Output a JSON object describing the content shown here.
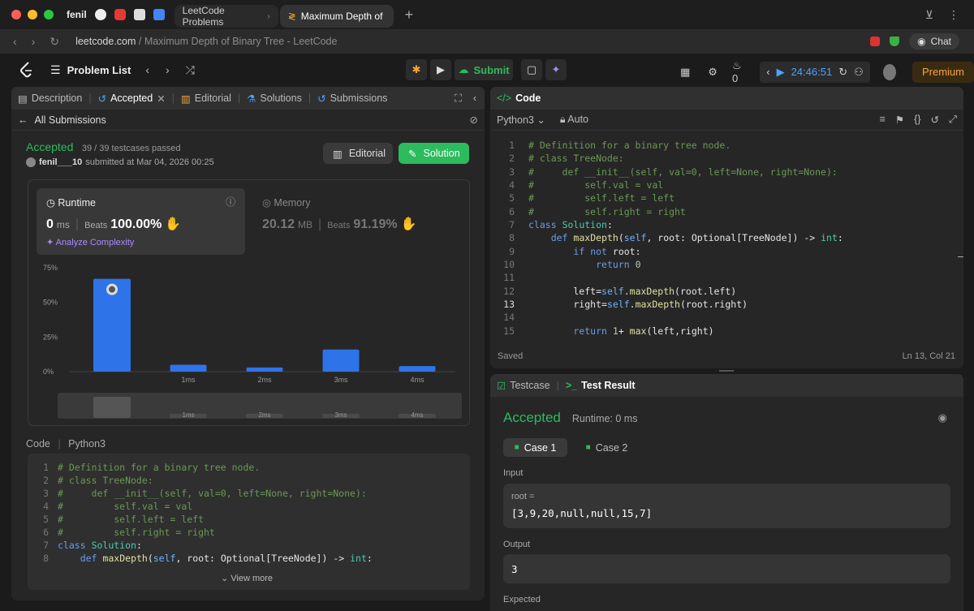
{
  "browser": {
    "profile": "fenil",
    "tabs": [
      {
        "title": "LeetCode Problems",
        "active": false
      },
      {
        "title": "Maximum Depth of Bina",
        "active": true
      }
    ],
    "url_domain": "leetcode.com",
    "url_path": " / Maximum Depth of Binary Tree - LeetCode",
    "chat_label": "Chat"
  },
  "header": {
    "problem_list": "Problem List",
    "submit": "Submit",
    "streak": "0",
    "timer": "24:46:51",
    "premium": "Premium"
  },
  "left": {
    "tabs": [
      "Description",
      "Accepted",
      "Editorial",
      "Solutions",
      "Submissions"
    ],
    "all_submissions": "All Submissions",
    "status": "Accepted",
    "testcases": "39 / 39 testcases passed",
    "user": "fenil___10",
    "submitted": "submitted at Mar 04, 2026 00:25",
    "editorial_btn": "Editorial",
    "solution_btn": "Solution",
    "runtime_label": "Runtime",
    "runtime_value": "0",
    "runtime_unit": "ms",
    "beats_label": "Beats",
    "runtime_beats": "100.00%",
    "analyze": "Analyze Complexity",
    "memory_label": "Memory",
    "memory_value": "20.12",
    "memory_unit": "MB",
    "memory_beats": "91.19%",
    "code_label": "Code",
    "code_lang": "Python3",
    "view_more": "View more"
  },
  "chart_data": {
    "type": "bar",
    "y_ticks": [
      "75%",
      "50%",
      "25%",
      "0%"
    ],
    "ylim": [
      0,
      75
    ],
    "categories": [
      "0ms",
      "1ms",
      "2ms",
      "3ms",
      "4ms"
    ],
    "x_labels": [
      "",
      "1ms",
      "2ms",
      "3ms",
      "4ms"
    ],
    "values": [
      67,
      5,
      3,
      16,
      4
    ],
    "highlight_index": 0
  },
  "left_code": [
    "# Definition for a binary tree node.",
    "# class TreeNode:",
    "#     def __init__(self, val=0, left=None, right=None):",
    "#         self.val = val",
    "#         self.left = left",
    "#         self.right = right",
    "class Solution:",
    "    def maxDepth(self, root: Optional[TreeNode]) -> int:"
  ],
  "editor": {
    "title": "Code",
    "lang": "Python3",
    "auto": "Auto",
    "saved": "Saved",
    "position": "Ln 13, Col 21",
    "lines": [
      "# Definition for a binary tree node.",
      "# class TreeNode:",
      "#     def __init__(self, val=0, left=None, right=None):",
      "#         self.val = val",
      "#         self.left = left",
      "#         self.right = right",
      "class Solution:",
      "    def maxDepth(self, root: Optional[TreeNode]) -> int:",
      "        if not root:",
      "            return 0",
      "",
      "        left=self.maxDepth(root.left)",
      "        right=self.maxDepth(root.right)",
      "",
      "        return 1+ max(left,right)"
    ]
  },
  "result": {
    "testcase_tab": "Testcase",
    "result_tab": "Test Result",
    "status": "Accepted",
    "runtime": "Runtime: 0 ms",
    "case1": "Case 1",
    "case2": "Case 2",
    "input_label": "Input",
    "input_var": "root =",
    "input_value": "[3,9,20,null,null,15,7]",
    "output_label": "Output",
    "output_value": "3",
    "expected_label": "Expected"
  }
}
